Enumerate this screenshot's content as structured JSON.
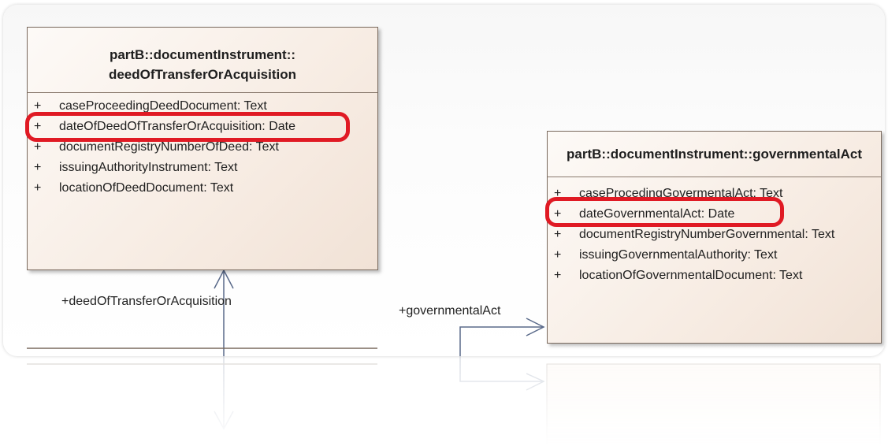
{
  "diagram": {
    "left_class": {
      "title_line1": "partB::documentInstrument::",
      "title_line2": "deedOfTransferOrAcquisition",
      "attributes": [
        {
          "vis": "+",
          "text": "caseProceedingDeedDocument: Text"
        },
        {
          "vis": "+",
          "text": "dateOfDeedOfTransferOrAcquisition: Date"
        },
        {
          "vis": "+",
          "text": "documentRegistryNumberOfDeed: Text"
        },
        {
          "vis": "+",
          "text": "issuingAuthorityInstrument: Text"
        },
        {
          "vis": "+",
          "text": "locationOfDeedDocument: Text"
        }
      ]
    },
    "right_class": {
      "title": "partB::documentInstrument::governmentalAct",
      "attributes": [
        {
          "vis": "+",
          "text": "caseProcedingGovermentalAct: Text"
        },
        {
          "vis": "+",
          "text": "dateGovernmentalAct: Date"
        },
        {
          "vis": "+",
          "text": "documentRegistryNumberGovernmental: Text"
        },
        {
          "vis": "+",
          "text": "issuingGovernmentalAuthority: Text"
        },
        {
          "vis": "+",
          "text": "locationOfGovernmentalDocument: Text"
        }
      ]
    },
    "left_role": "+deedOfTransferOrAcquisition",
    "right_role": "+governmentalAct",
    "highlight_color": "#e01a24",
    "class_fill": "#f7ece3",
    "line_color": "#5a6a8a"
  }
}
